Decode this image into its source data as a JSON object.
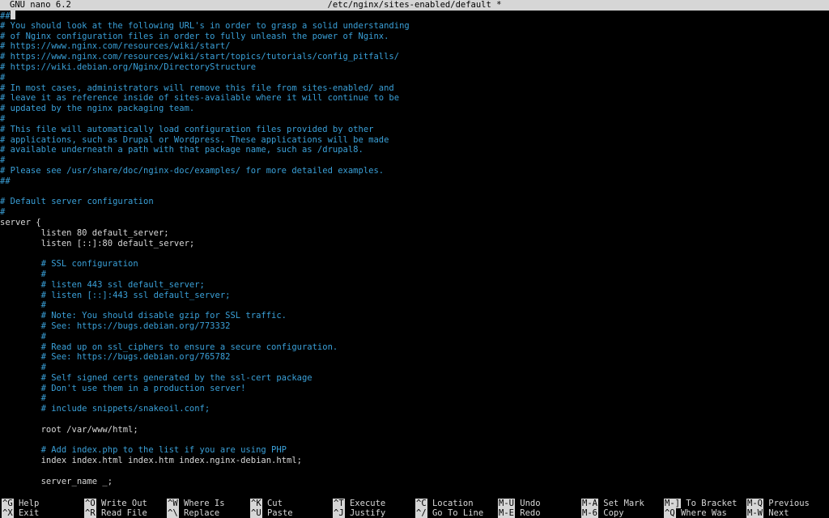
{
  "title_bar": {
    "app_name": "GNU nano 6.2",
    "file_path": "/etc/nginx/sites-enabled/default *"
  },
  "editor": {
    "lines": [
      {
        "text": "##",
        "type": "comment",
        "cursor": true
      },
      {
        "text": "# You should look at the following URL's in order to grasp a solid understanding",
        "type": "comment"
      },
      {
        "text": "# of Nginx configuration files in order to fully unleash the power of Nginx.",
        "type": "comment"
      },
      {
        "text": "# https://www.nginx.com/resources/wiki/start/",
        "type": "comment"
      },
      {
        "text": "# https://www.nginx.com/resources/wiki/start/topics/tutorials/config_pitfalls/",
        "type": "comment"
      },
      {
        "text": "# https://wiki.debian.org/Nginx/DirectoryStructure",
        "type": "comment"
      },
      {
        "text": "#",
        "type": "comment"
      },
      {
        "text": "# In most cases, administrators will remove this file from sites-enabled/ and",
        "type": "comment"
      },
      {
        "text": "# leave it as reference inside of sites-available where it will continue to be",
        "type": "comment"
      },
      {
        "text": "# updated by the nginx packaging team.",
        "type": "comment"
      },
      {
        "text": "#",
        "type": "comment"
      },
      {
        "text": "# This file will automatically load configuration files provided by other",
        "type": "comment"
      },
      {
        "text": "# applications, such as Drupal or Wordpress. These applications will be made",
        "type": "comment"
      },
      {
        "text": "# available underneath a path with that package name, such as /drupal8.",
        "type": "comment"
      },
      {
        "text": "#",
        "type": "comment"
      },
      {
        "text": "# Please see /usr/share/doc/nginx-doc/examples/ for more detailed examples.",
        "type": "comment"
      },
      {
        "text": "##",
        "type": "comment"
      },
      {
        "text": "",
        "type": "code"
      },
      {
        "text": "# Default server configuration",
        "type": "comment"
      },
      {
        "text": "#",
        "type": "comment"
      },
      {
        "text": "server {",
        "type": "code"
      },
      {
        "text": "        listen 80 default_server;",
        "type": "code"
      },
      {
        "text": "        listen [::]:80 default_server;",
        "type": "code"
      },
      {
        "text": "",
        "type": "code"
      },
      {
        "text": "        # SSL configuration",
        "type": "comment"
      },
      {
        "text": "        #",
        "type": "comment"
      },
      {
        "text": "        # listen 443 ssl default_server;",
        "type": "comment"
      },
      {
        "text": "        # listen [::]:443 ssl default_server;",
        "type": "comment"
      },
      {
        "text": "        #",
        "type": "comment"
      },
      {
        "text": "        # Note: You should disable gzip for SSL traffic.",
        "type": "comment"
      },
      {
        "text": "        # See: https://bugs.debian.org/773332",
        "type": "comment"
      },
      {
        "text": "        #",
        "type": "comment"
      },
      {
        "text": "        # Read up on ssl_ciphers to ensure a secure configuration.",
        "type": "comment"
      },
      {
        "text": "        # See: https://bugs.debian.org/765782",
        "type": "comment"
      },
      {
        "text": "        #",
        "type": "comment"
      },
      {
        "text": "        # Self signed certs generated by the ssl-cert package",
        "type": "comment"
      },
      {
        "text": "        # Don't use them in a production server!",
        "type": "comment"
      },
      {
        "text": "        #",
        "type": "comment"
      },
      {
        "text": "        # include snippets/snakeoil.conf;",
        "type": "comment"
      },
      {
        "text": "",
        "type": "code"
      },
      {
        "text": "        root /var/www/html;",
        "type": "code"
      },
      {
        "text": "",
        "type": "code"
      },
      {
        "text": "        # Add index.php to the list if you are using PHP",
        "type": "comment"
      },
      {
        "text": "        index index.html index.htm index.nginx-debian.html;",
        "type": "code"
      },
      {
        "text": "",
        "type": "code"
      },
      {
        "text": "        server_name _;",
        "type": "code"
      }
    ]
  },
  "shortcuts": {
    "top_row": [
      {
        "key": "^G",
        "label": "Help"
      },
      {
        "key": "^O",
        "label": "Write Out"
      },
      {
        "key": "^W",
        "label": "Where Is"
      },
      {
        "key": "^K",
        "label": "Cut"
      },
      {
        "key": "^T",
        "label": "Execute"
      },
      {
        "key": "^C",
        "label": "Location"
      },
      {
        "key": "M-U",
        "label": "Undo"
      },
      {
        "key": "M-A",
        "label": "Set Mark"
      },
      {
        "key": "M-]",
        "label": "To Bracket"
      },
      {
        "key": "M-Q",
        "label": "Previous"
      }
    ],
    "bottom_row": [
      {
        "key": "^X",
        "label": "Exit"
      },
      {
        "key": "^R",
        "label": "Read File"
      },
      {
        "key": "^\\",
        "label": "Replace"
      },
      {
        "key": "^U",
        "label": "Paste"
      },
      {
        "key": "^J",
        "label": "Justify"
      },
      {
        "key": "^/",
        "label": "Go To Line"
      },
      {
        "key": "M-E",
        "label": "Redo"
      },
      {
        "key": "M-6",
        "label": "Copy"
      },
      {
        "key": "^Q",
        "label": "Where Was"
      },
      {
        "key": "M-W",
        "label": "Next"
      }
    ]
  },
  "colors": {
    "background": "#000000",
    "comment": "#3aa0d8",
    "text": "#d8d8d8",
    "inverse_bg": "#d6d6d6"
  }
}
